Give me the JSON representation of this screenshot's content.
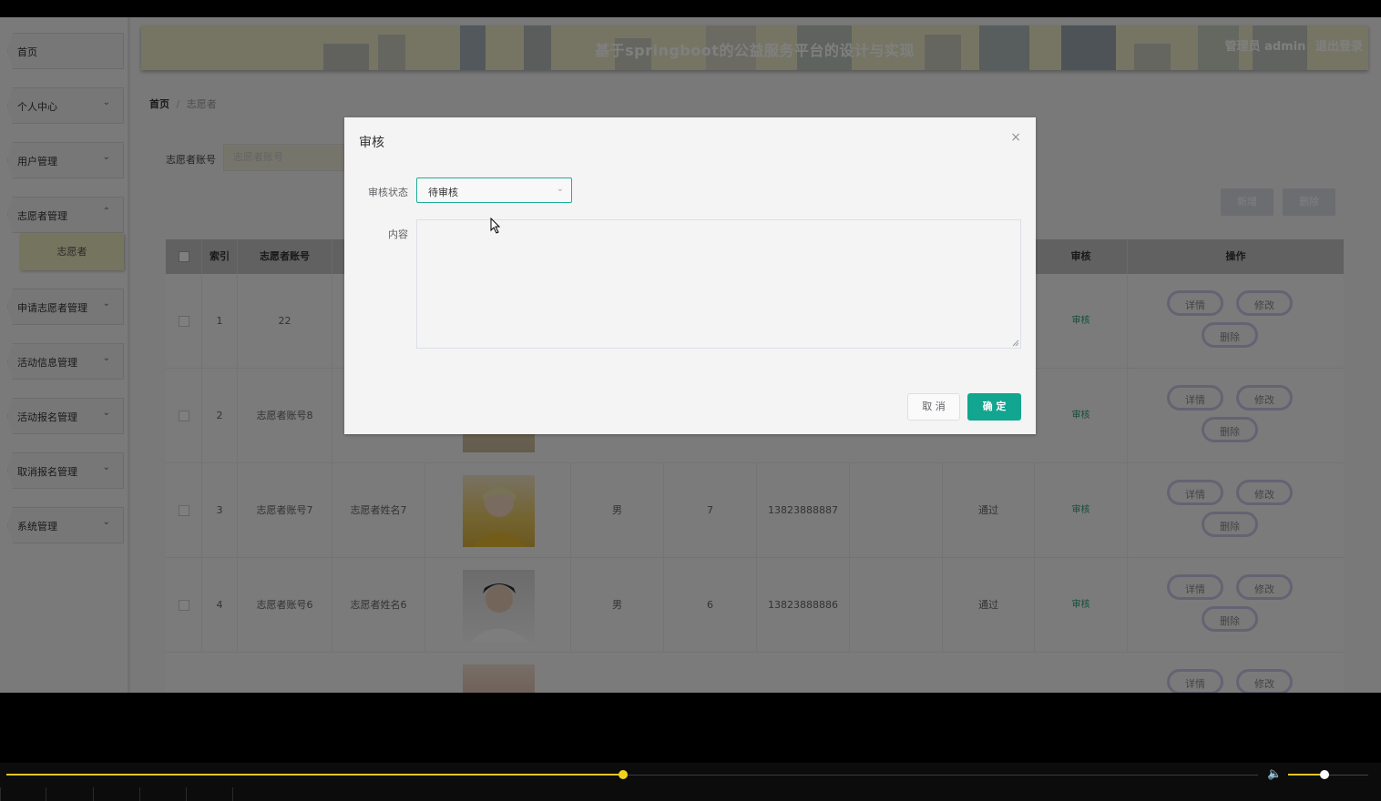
{
  "header": {
    "title": "基于springboot的公益服务平台的设计与实现",
    "role": "管理员 admin",
    "logout": "退出登录"
  },
  "sidebar": {
    "items": [
      {
        "label": "首页",
        "chevron": ""
      },
      {
        "label": "个人中心",
        "chevron": "⌄"
      },
      {
        "label": "用户管理",
        "chevron": "⌄"
      },
      {
        "label": "志愿者管理",
        "chevron": "⌃"
      },
      {
        "label": "申请志愿者管理",
        "chevron": "⌄"
      },
      {
        "label": "活动信息管理",
        "chevron": "⌄"
      },
      {
        "label": "活动报名管理",
        "chevron": "⌄"
      },
      {
        "label": "取消报名管理",
        "chevron": "⌄"
      },
      {
        "label": "系统管理",
        "chevron": "⌄"
      }
    ],
    "sub_item": "志愿者"
  },
  "breadcrumb": {
    "home": "首页",
    "separator": "/",
    "current": "志愿者"
  },
  "search": {
    "label": "志愿者账号",
    "placeholder": "志愿者账号"
  },
  "toolbar": {
    "add_label": "新增",
    "delete_label": "删除"
  },
  "table": {
    "headers": {
      "index": "索引",
      "account": "志愿者账号",
      "audit": "审核",
      "ops": "操作"
    },
    "rows": [
      {
        "index": "1",
        "account": "22",
        "name": "",
        "gender": "",
        "age": "",
        "phone": "",
        "status": "",
        "audit": "审核"
      },
      {
        "index": "2",
        "account": "志愿者账号8",
        "name": "",
        "gender": "",
        "age": "",
        "phone": "",
        "status": "",
        "audit": "审核"
      },
      {
        "index": "3",
        "account": "志愿者账号7",
        "name": "志愿者姓名7",
        "gender": "男",
        "age": "7",
        "phone": "13823888887",
        "status": "通过",
        "audit": "审核"
      },
      {
        "index": "4",
        "account": "志愿者账号6",
        "name": "志愿者姓名6",
        "gender": "男",
        "age": "6",
        "phone": "13823888886",
        "status": "通过",
        "audit": "审核"
      },
      {
        "index": "",
        "account": "",
        "name": "",
        "gender": "",
        "age": "",
        "phone": "",
        "status": "",
        "audit": ""
      }
    ],
    "ops": {
      "detail": "详情",
      "edit": "修改",
      "delete": "删除"
    }
  },
  "dialog": {
    "title": "审核",
    "close": "×",
    "status_label": "审核状态",
    "status_value": "待审核",
    "content_label": "内容",
    "content_value": "",
    "cancel": "取 消",
    "confirm": "确 定"
  },
  "player": {
    "progress": 0.493,
    "volume": 0.45
  },
  "colors": {
    "accent": "#12a590",
    "header_bg": "#ecebc8",
    "progress": "#e3c624"
  }
}
